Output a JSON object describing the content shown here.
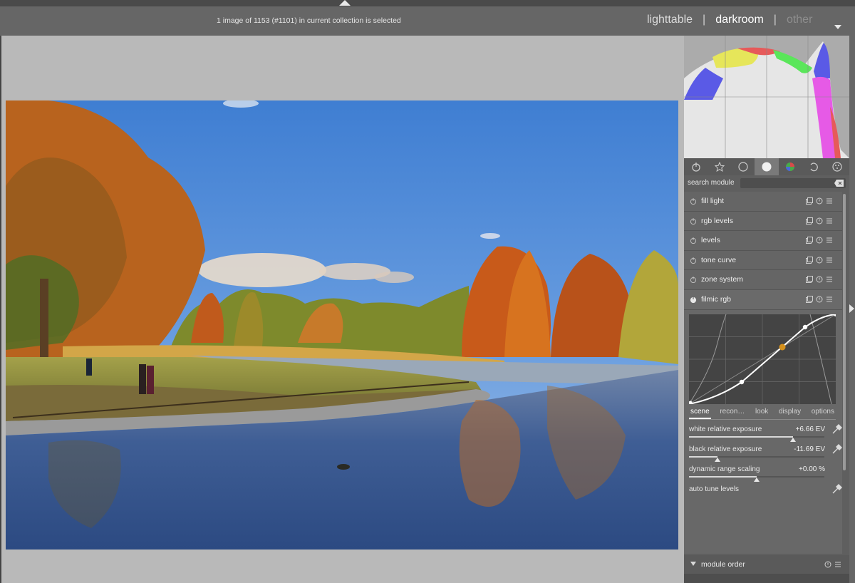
{
  "header": {
    "status": "1 image of 1153 (#1101) in current collection is selected",
    "views": {
      "lighttable": "lighttable",
      "darkroom": "darkroom",
      "other": "other",
      "separator": "|"
    },
    "active_view": "darkroom"
  },
  "icons": {
    "top_arrow": "expand-top-panel-icon",
    "view_dropdown": "chevron-down-icon",
    "collapse_right": "collapse-right-panel-icon",
    "group_tabs": [
      "power-icon",
      "star-icon",
      "circle-icon",
      "tone-icon",
      "color-icon",
      "correct-icon",
      "effect-icon"
    ],
    "module_power": "power-icon",
    "module_actions": [
      "presets-icon",
      "reset-icon",
      "menu-icon"
    ],
    "picker": "color-picker-icon"
  },
  "histogram": {
    "colors": {
      "blue": "#5a5ae6",
      "yellow": "#e6e65a",
      "red": "#e65a5a",
      "magenta": "#e65ae6",
      "green": "#5ae65a",
      "white": "#e6e6e6"
    }
  },
  "right_panel": {
    "search_label": "search module",
    "active_group": 3,
    "modules": [
      {
        "name": "fill light"
      },
      {
        "name": "rgb levels"
      },
      {
        "name": "levels"
      },
      {
        "name": "tone curve"
      },
      {
        "name": "zone system"
      },
      {
        "name": "filmic rgb"
      }
    ],
    "filmic": {
      "tabs": [
        "scene",
        "recon…",
        "look",
        "display",
        "options"
      ],
      "active_tab": "scene",
      "sliders": [
        {
          "label": "white relative exposure",
          "value": "+6.66 EV",
          "fraction": 0.77
        },
        {
          "label": "black relative exposure",
          "value": "-11.69 EV",
          "fraction": 0.21
        },
        {
          "label": "dynamic range scaling",
          "value": "+0.00 %",
          "fraction": 0.5
        }
      ],
      "auto_tune_label": "auto tune levels",
      "curve_accent": "#d4901c"
    },
    "module_order_label": "module order"
  }
}
